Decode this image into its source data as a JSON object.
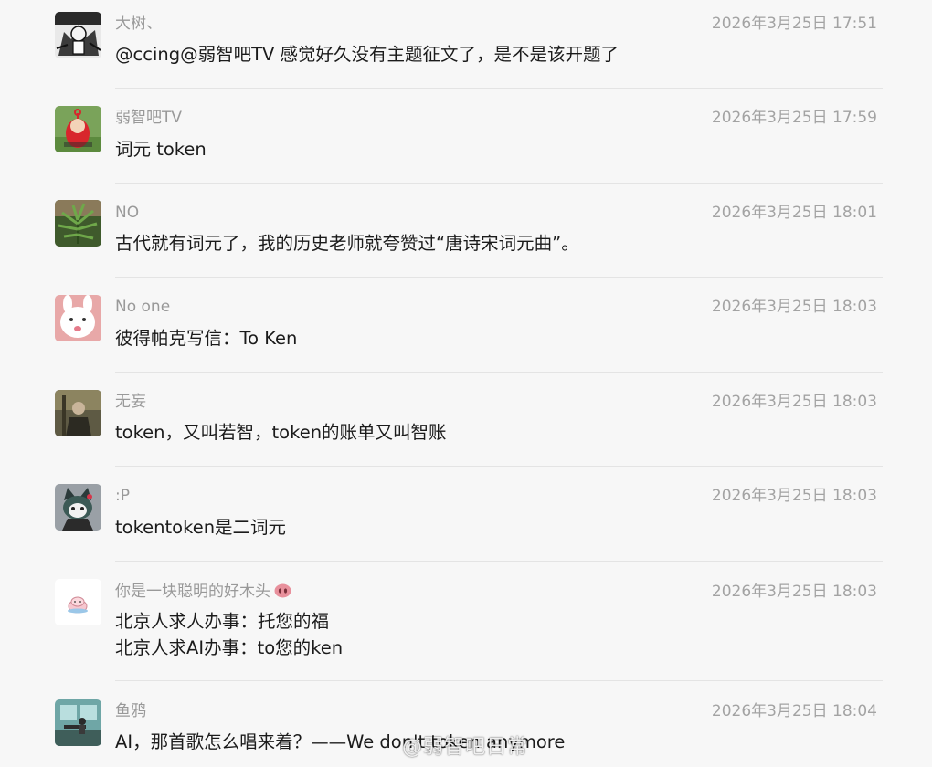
{
  "comments": [
    {
      "username": "大树、",
      "time": "2026年3月25日 17:51",
      "text": "@ccing@弱智吧TV 感觉好久没有主题征文了，是不是该开题了"
    },
    {
      "username": "弱智吧TV",
      "time": "2026年3月25日 17:59",
      "text": "词元 token"
    },
    {
      "username": "NO",
      "time": "2026年3月25日 18:01",
      "text": "古代就有词元了，我的历史老师就夸赞过“唐诗宋词元曲”。"
    },
    {
      "username": "No one",
      "time": "2026年3月25日 18:03",
      "text": "彼得帕克写信：To Ken"
    },
    {
      "username": "无妄",
      "time": "2026年3月25日 18:03",
      "text": "token，又叫若智，token的账单又叫智账"
    },
    {
      "username": ":P",
      "time": "2026年3月25日 18:03",
      "text": "tokentoken是二词元"
    },
    {
      "username": "你是一块聪明的好木头",
      "badge_icon": "pig-nose-emoji-icon",
      "time": "2026年3月25日 18:03",
      "text": "北京人求人办事：托您的福",
      "text2": "北京人求AI办事：to您的ken"
    },
    {
      "username": "鱼鸦",
      "time": "2026年3月25日 18:04",
      "text": "AI，那首歌怎么唱来着？——We don't token anymore"
    }
  ],
  "watermark": "@弱智吧日常",
  "colors": {
    "background": "#f7f7f7",
    "username": "#999999",
    "timestamp": "#a3a3a3",
    "text": "#1b1b1b",
    "divider": "#e4e4e4"
  }
}
